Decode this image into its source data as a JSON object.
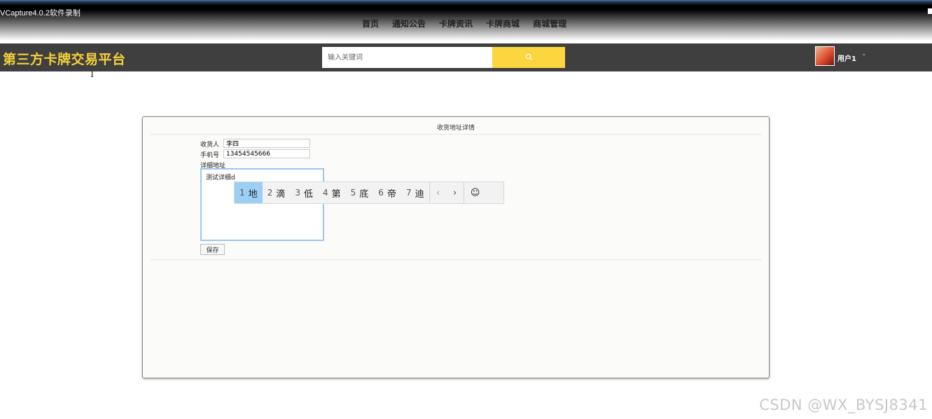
{
  "recorder_label": "VCapture4.0.2软件录制",
  "nav": {
    "items": [
      "首页",
      "通知公告",
      "卡牌资讯",
      "卡牌商城",
      "商城管理"
    ],
    "dropdown_indicator": "﹀"
  },
  "header": {
    "brand": "第三方卡牌交易平台",
    "search_placeholder": "输入关键词",
    "search_icon": "search-icon",
    "user_name": "用户1",
    "user_caret": "-"
  },
  "panel": {
    "title": "收货地址详情",
    "receiver_label": "收货人",
    "receiver_value": "李四",
    "phone_label": "手机号",
    "phone_value": "13454545666",
    "address_label": "详细地址",
    "address_value": "测试详细d",
    "save_label": "保存"
  },
  "ime": {
    "candidates": [
      {
        "n": "1",
        "c": "地"
      },
      {
        "n": "2",
        "c": "滴"
      },
      {
        "n": "3",
        "c": "低"
      },
      {
        "n": "4",
        "c": "第"
      },
      {
        "n": "5",
        "c": "底"
      },
      {
        "n": "6",
        "c": "帝"
      },
      {
        "n": "7",
        "c": "迪"
      }
    ],
    "prev": "‹",
    "next": "›",
    "emoji": "☺"
  },
  "watermark": "CSDN @WX_BYSJ8341",
  "colors": {
    "brand": "#f5d13a",
    "search_button": "#fbd63f",
    "header_bg": "#3f3f3f",
    "ime_selected": "#9dcff5"
  }
}
